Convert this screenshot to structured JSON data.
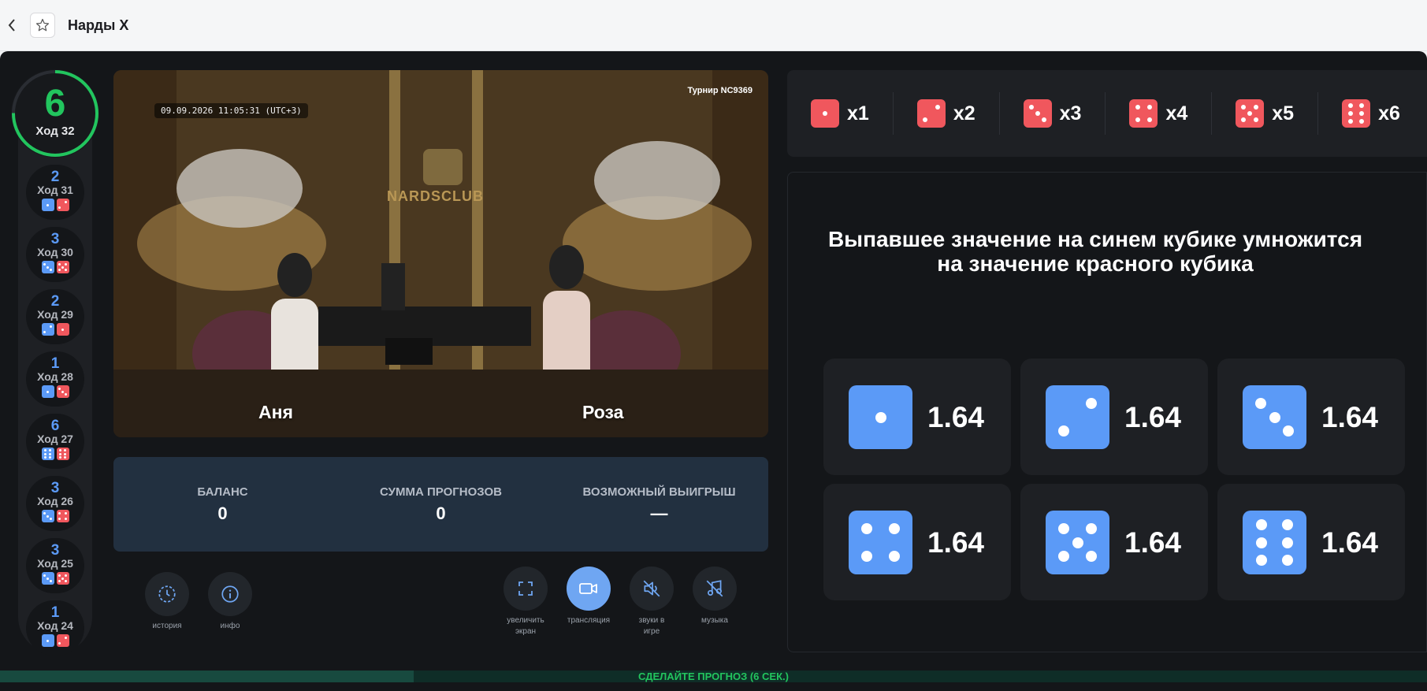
{
  "browser": {
    "tab_title": "Нарды X",
    "back_icon": "chevron-left-icon",
    "star_icon": "star-icon"
  },
  "current_move": {
    "value": "6",
    "label": "Ход 32",
    "ring_color": "#22c55e"
  },
  "history": [
    {
      "value": "2",
      "label": "Ход 31",
      "blue": 1,
      "red": 2
    },
    {
      "value": "3",
      "label": "Ход 30",
      "blue": 3,
      "red": 5
    },
    {
      "value": "2",
      "label": "Ход 29",
      "blue": 2,
      "red": 1
    },
    {
      "value": "1",
      "label": "Ход 28",
      "blue": 1,
      "red": 3
    },
    {
      "value": "6",
      "label": "Ход 27",
      "blue": 6,
      "red": 6
    },
    {
      "value": "3",
      "label": "Ход 26",
      "blue": 3,
      "red": 4
    },
    {
      "value": "3",
      "label": "Ход 25",
      "blue": 3,
      "red": 5
    },
    {
      "value": "1",
      "label": "Ход 24",
      "blue": 1,
      "red": 2
    }
  ],
  "video": {
    "timestamp": "09.09.2026 11:05:31 (UTC+3)",
    "tournament": "Турнир NC9369",
    "logo_text": "NARDSCLUB",
    "player_left": "Аня",
    "player_right": "Роза"
  },
  "balances": {
    "balance_title": "БАЛАНС",
    "balance_value": "0",
    "sum_title": "СУММА ПРОГНОЗОВ",
    "sum_value": "0",
    "win_title": "ВОЗМОЖНЫЙ ВЫИГРЫШ",
    "win_value": "—"
  },
  "controls": {
    "history_label": "история",
    "info_label": "инфо",
    "fullscreen_label": "увеличить экран",
    "stream_label": "трансляция",
    "sounds_label": "звуки в игре",
    "music_label": "музыка"
  },
  "multipliers": [
    {
      "label": "x1",
      "pips": 1
    },
    {
      "label": "x2",
      "pips": 2
    },
    {
      "label": "x3",
      "pips": 3
    },
    {
      "label": "x4",
      "pips": 4
    },
    {
      "label": "x5",
      "pips": 5
    },
    {
      "label": "x6",
      "pips": 6
    }
  ],
  "headline": "Выпавшее значение на синем кубике умножится на значение красного кубика",
  "odds": [
    {
      "pips": 1,
      "value": "1.64"
    },
    {
      "pips": 2,
      "value": "1.64"
    },
    {
      "pips": 3,
      "value": "1.64"
    },
    {
      "pips": 4,
      "value": "1.64"
    },
    {
      "pips": 5,
      "value": "1.64"
    },
    {
      "pips": 6,
      "value": "1.64"
    }
  ],
  "timer": {
    "text": "СДЕЛАЙТЕ ПРОГНОЗ (6 СЕК.)",
    "progress": 0.29
  },
  "colors": {
    "blue_die": "#5b9af7",
    "red_die": "#f0575d",
    "accent_green": "#22c55e"
  }
}
